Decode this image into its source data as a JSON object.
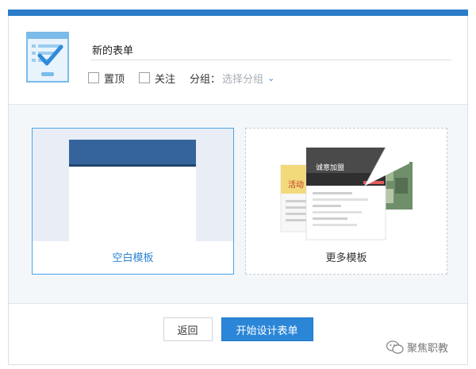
{
  "form": {
    "name_value": "新的表单",
    "pin_label": "置顶",
    "follow_label": "关注",
    "group_label": "分组：",
    "group_placeholder": "选择分组"
  },
  "templates": {
    "blank_label": "空白模板",
    "more_label": "更多模板",
    "preview_texts": [
      "诚意加盟",
      "活动"
    ]
  },
  "footer": {
    "back_label": "返回",
    "start_label": "开始设计表单"
  },
  "watermark": {
    "text": "聚焦职教"
  },
  "colors": {
    "accent": "#2b7cc9",
    "selected_border": "#4aa3e6",
    "primary_button": "#2b86d8"
  }
}
